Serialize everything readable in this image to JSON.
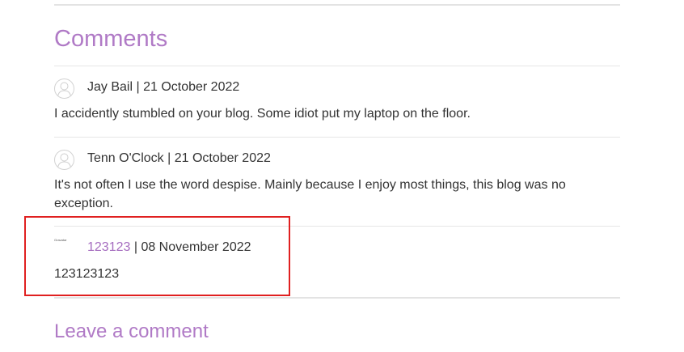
{
  "comments_section": {
    "heading": "Comments",
    "comments": [
      {
        "author": "Jay Bail",
        "separator": " | ",
        "date": "21 October 2022",
        "text": "I accidently stumbled on your blog. Some idiot put my laptop on the floor.",
        "avatar_icon": "default-avatar-icon"
      },
      {
        "author": "Tenn O'Clock",
        "separator": " | ",
        "date": "21 October 2022",
        "text": "It's not often I use the word despise. Mainly because I enjoy most things, this blog was no exception.",
        "avatar_icon": "default-avatar-icon"
      },
      {
        "author": "123123",
        "separator": " | ",
        "date": "08 November 2022",
        "text": "123123123",
        "avatar_icon": "broken-image-icon",
        "avatar_alt": "Gravatar"
      }
    ]
  },
  "leave_comment": {
    "heading": "Leave a comment"
  },
  "colors": {
    "accent": "#b07ac6",
    "link": "#a56cbf",
    "text": "#333333",
    "divider": "#e6e6e6",
    "highlight": "#e02020"
  }
}
